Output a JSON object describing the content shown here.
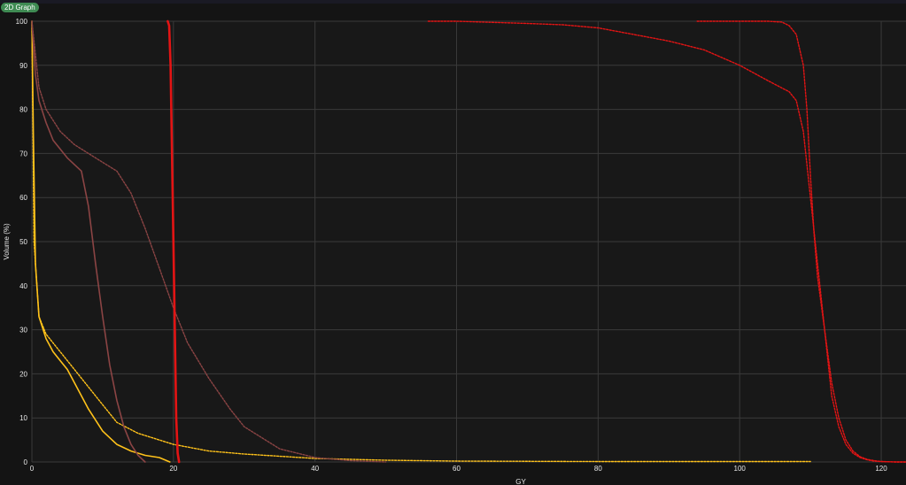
{
  "tab": {
    "label": "2D Graph"
  },
  "chart_data": {
    "type": "line",
    "title": "",
    "xlabel": "GY",
    "ylabel": "Volume (%)",
    "xlim": [
      0,
      123.5
    ],
    "ylim": [
      0,
      100
    ],
    "xticks": [
      0,
      20,
      40,
      60,
      80,
      100,
      120
    ],
    "yticks": [
      0,
      10,
      20,
      30,
      40,
      50,
      60,
      70,
      80,
      90,
      100
    ],
    "grid": true,
    "legend": "none",
    "series": [
      {
        "color": "#ffc21a",
        "style": "solid",
        "x": [
          0,
          0.2,
          0.5,
          1,
          2,
          3,
          4,
          5,
          6,
          8,
          10,
          12,
          14,
          16,
          18,
          19.5
        ],
        "y": [
          100,
          75,
          45,
          33,
          28,
          25,
          23,
          21,
          18,
          12,
          7,
          4,
          2.5,
          1.5,
          1,
          0
        ]
      },
      {
        "color": "#ffc21a",
        "style": "dotted",
        "x": [
          0,
          0.3,
          1,
          2,
          4,
          6,
          8,
          10,
          12,
          15,
          20,
          25,
          30,
          40,
          50,
          60,
          80,
          100,
          110
        ],
        "y": [
          100,
          50,
          33,
          29,
          25,
          21,
          17,
          13,
          9,
          6.5,
          4,
          2.5,
          1.8,
          0.8,
          0.4,
          0.2,
          0.1,
          0.1,
          0.1
        ]
      },
      {
        "color": "#8b4444",
        "style": "solid",
        "x": [
          0,
          0.5,
          1,
          2,
          3,
          5,
          7,
          8,
          9,
          10,
          11,
          12,
          13,
          14,
          15,
          16
        ],
        "y": [
          100,
          88,
          82,
          77,
          73,
          69,
          66,
          58,
          45,
          33,
          22,
          14,
          8,
          4,
          1.5,
          0
        ]
      },
      {
        "color": "#8b4444",
        "style": "dotted",
        "x": [
          0,
          1,
          2,
          4,
          6,
          8,
          10,
          12,
          14,
          16,
          18,
          20,
          22,
          25,
          28,
          30,
          35,
          40,
          45,
          50
        ],
        "y": [
          100,
          85,
          80,
          75,
          72,
          70,
          68,
          66,
          61,
          53,
          44,
          35,
          27,
          19,
          12,
          8,
          3,
          1,
          0.3,
          0
        ]
      },
      {
        "color": "#e31414",
        "style": "solid",
        "x": [
          19.2,
          19.4,
          19.6,
          19.8,
          20,
          20.2,
          20.4,
          20.6,
          20.8
        ],
        "y": [
          100,
          99,
          90,
          70,
          50,
          30,
          10,
          2,
          0
        ]
      },
      {
        "color": "#e31414",
        "style": "dotted",
        "x": [
          56,
          60,
          70,
          75,
          80,
          85,
          90,
          95,
          100,
          104,
          107,
          108,
          109,
          110,
          111,
          112,
          113,
          114,
          115,
          116,
          117,
          118,
          119,
          120,
          122,
          123.5
        ],
        "y": [
          100,
          100,
          99.5,
          99.2,
          98.5,
          97,
          95.5,
          93.5,
          90,
          86.5,
          84,
          82,
          75,
          60,
          45,
          30,
          15,
          8,
          4,
          2,
          1,
          0.5,
          0.2,
          0.1,
          0,
          0
        ]
      },
      {
        "color": "#e31414",
        "style": "dotted",
        "x": [
          94,
          100,
          104,
          106,
          107,
          108,
          109,
          109.5,
          110,
          110.5,
          111,
          112,
          113,
          114,
          115,
          116,
          117,
          118,
          119,
          120,
          122,
          123.5
        ],
        "y": [
          100,
          100,
          100,
          99.8,
          99,
          97,
          90,
          80,
          65,
          52,
          42,
          30,
          18,
          10,
          5,
          2.5,
          1.2,
          0.6,
          0.3,
          0.1,
          0,
          0
        ]
      }
    ]
  }
}
